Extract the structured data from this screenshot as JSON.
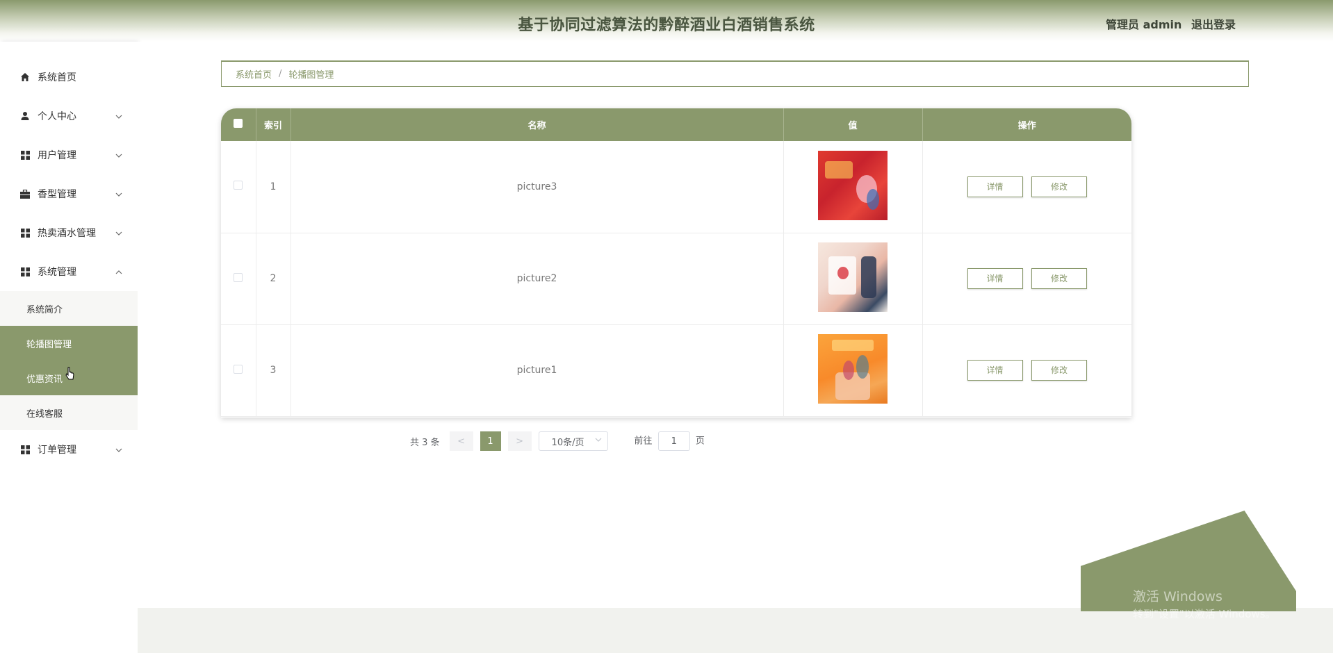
{
  "header": {
    "title": "基于协同过滤算法的黔醉酒业白酒销售系统",
    "role_user": "管理员 admin",
    "logout": "退出登录"
  },
  "sidebar": {
    "items": [
      {
        "label": "系统首页",
        "icon": "home-icon"
      },
      {
        "label": "个人中心",
        "icon": "user-icon",
        "chevron": "down"
      },
      {
        "label": "用户管理",
        "icon": "grid-icon",
        "chevron": "down"
      },
      {
        "label": "香型管理",
        "icon": "briefcase-icon",
        "chevron": "down"
      },
      {
        "label": "热卖酒水管理",
        "icon": "grid-icon",
        "chevron": "down"
      },
      {
        "label": "系统管理",
        "icon": "grid-icon",
        "chevron": "up"
      },
      {
        "label": "订单管理",
        "icon": "grid-icon",
        "chevron": "down"
      }
    ],
    "submenu": [
      {
        "label": "系统简介"
      },
      {
        "label": "轮播图管理",
        "active": true
      },
      {
        "label": "优惠资讯",
        "hover": true
      },
      {
        "label": "在线客服"
      }
    ]
  },
  "breadcrumb": {
    "home": "系统首页",
    "separator": "/",
    "current": "轮播图管理"
  },
  "table": {
    "headers": [
      "索引",
      "名称",
      "值",
      "操作"
    ],
    "rows": [
      {
        "index": "1",
        "name": "picture3",
        "thumb": "red-banner-image"
      },
      {
        "index": "2",
        "name": "picture2",
        "thumb": "pink-banner-image"
      },
      {
        "index": "3",
        "name": "picture1",
        "thumb": "orange-banner-image"
      }
    ],
    "detail_label": "详情",
    "edit_label": "修改"
  },
  "pagination": {
    "total": "共 3 条",
    "prev": "<",
    "current_page": "1",
    "next": ">",
    "page_size": "10条/页",
    "goto_prefix": "前往",
    "goto_value": "1",
    "goto_suffix": "页"
  },
  "watermark": {
    "line1": "激活 Windows",
    "line2": "转到\"设置\"以激活 Windows。"
  },
  "colors": {
    "accent": "#8a996c"
  }
}
